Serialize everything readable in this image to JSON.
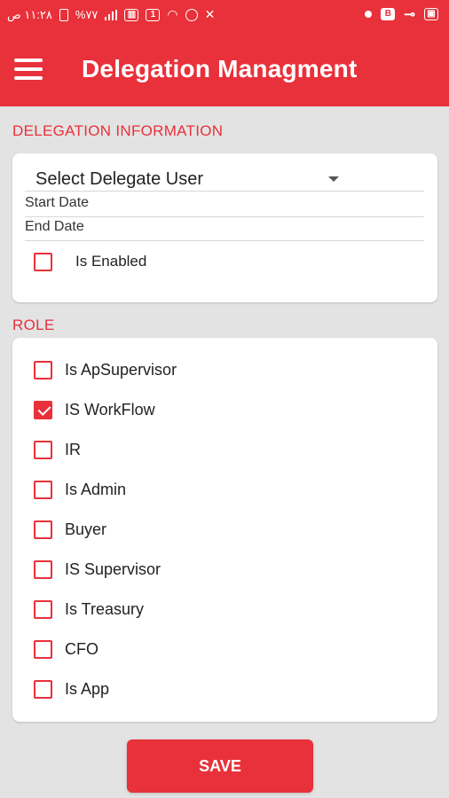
{
  "status_bar": {
    "time": "١١:٢٨ ص",
    "battery": "%٧٧",
    "icons": [
      "battery-icon",
      "signal-icon",
      "sim-icon",
      "wifi-icon",
      "alarm-icon",
      "mute-icon",
      "dot-icon",
      "b-icon",
      "key-icon",
      "image-icon"
    ]
  },
  "appbar": {
    "title": "Delegation Managment",
    "menu_icon": "hamburger-menu-icon"
  },
  "delegation": {
    "section_title": "DELEGATION INFORMATION",
    "select_delegate": "Select Delegate User",
    "start_date_placeholder": "Start Date",
    "end_date_placeholder": "End Date",
    "is_enabled": {
      "label": "Is Enabled",
      "checked": false
    }
  },
  "role": {
    "section_title": "ROLE",
    "items": [
      {
        "label": "Is ApSupervisor",
        "checked": false
      },
      {
        "label": "IS WorkFlow",
        "checked": true
      },
      {
        "label": "IR",
        "checked": false
      },
      {
        "label": "Is Admin",
        "checked": false
      },
      {
        "label": "Buyer",
        "checked": false
      },
      {
        "label": "IS Supervisor",
        "checked": false
      },
      {
        "label": "Is Treasury",
        "checked": false
      },
      {
        "label": "CFO",
        "checked": false
      },
      {
        "label": "Is App",
        "checked": false
      }
    ]
  },
  "save_label": "SAVE",
  "colors": {
    "accent": "#e8313a",
    "background": "#e3e3e3",
    "card": "#ffffff"
  }
}
